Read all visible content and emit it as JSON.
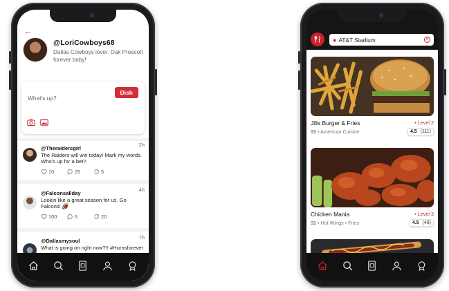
{
  "colors": {
    "brand_red": "#d12f36",
    "nav_bg": "#111111",
    "active_nav": "#c8242c"
  },
  "left_phone": {
    "profile": {
      "username": "@LoriCowboys68",
      "bio": "Dallas Cowboys lover. Dak Prescott forever baby!"
    },
    "compose": {
      "placeholder": "What's up?",
      "dish_button": "Dish",
      "icons": [
        "camera-icon",
        "image-icon"
      ]
    },
    "posts": [
      {
        "handle": "@Theraidersgirl",
        "time": "2h",
        "text": "The Raiders will win today! Mark my words. Who's up for a bet?",
        "likes": "10",
        "comments": "25",
        "shares": "5"
      },
      {
        "handle": "@Falconsallday",
        "time": "4h",
        "text": "Lookin like a great season for us. Go Falcons! 🏈",
        "likes": "100",
        "comments": "6",
        "shares": "20"
      },
      {
        "handle": "@Dallasmysoul",
        "time": "7h",
        "text": "What is going on right now?!! #Hurnsforever"
      }
    ],
    "nav": [
      "home-icon",
      "search-icon",
      "ticket-icon",
      "user-icon",
      "badge-icon"
    ]
  },
  "right_phone": {
    "search": {
      "value": "AT&T Stadium"
    },
    "restaurants": [
      {
        "name": "Jills Burger & Fries",
        "meta": "$$ • American Cuisine",
        "level": "• Level 2",
        "rating": "4.5",
        "count": "(111)"
      },
      {
        "name": "Chicken Mania",
        "meta": "$$ • Hot Wings • Fries",
        "level": "• Level 3",
        "rating": "4.5",
        "count": "(49)"
      }
    ],
    "nav": [
      "home-icon",
      "search-icon",
      "ticket-icon",
      "user-icon",
      "badge-icon"
    ]
  }
}
